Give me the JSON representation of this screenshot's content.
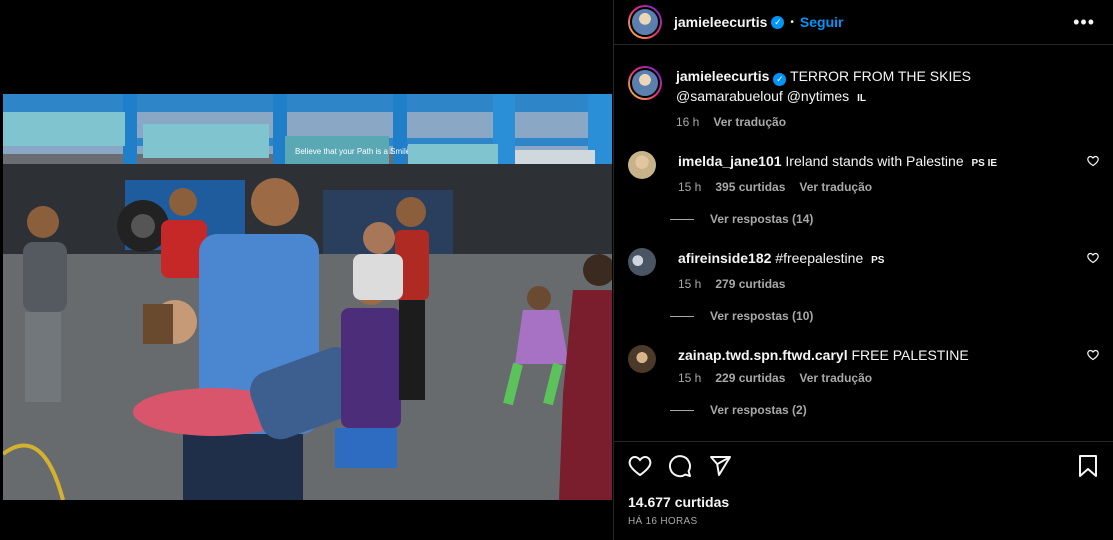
{
  "post": {
    "author": "jamieleecurtis",
    "follow_label": "Seguir",
    "separator": "•",
    "caption": {
      "text": "TERROR FROM THE SKIES @samarabuelouf @nytimes",
      "flag": "IL",
      "time": "16 h",
      "translate": "Ver tradução"
    }
  },
  "comments": [
    {
      "user": "imelda_jane101",
      "text": "Ireland stands with Palestine",
      "flag": "PS IE",
      "time": "15 h",
      "likes": "395 curtidas",
      "translate": "Ver tradução",
      "replies": "Ver respostas (14)"
    },
    {
      "user": "afireinside182",
      "text": "#freepalestine",
      "flag": "PS",
      "time": "15 h",
      "likes": "279 curtidas",
      "translate": "",
      "replies": "Ver respostas (10)"
    },
    {
      "user": "zainap.twd.spn.ftwd.caryl",
      "text": "FREE PALESTINE",
      "flag": "",
      "time": "15 h",
      "likes": "229 curtidas",
      "translate": "Ver tradução",
      "replies": "Ver respostas (2)"
    }
  ],
  "footer": {
    "likes": "14.677 curtidas",
    "posted": "HÁ 16 HORAS"
  },
  "photo_banners": {
    "left": "",
    "center": "Believe that your Path is a Smile from one",
    "right": ""
  },
  "colors": {
    "accent": "#0095f6",
    "panel_border": "#262626",
    "muted": "#a8a8a8"
  }
}
